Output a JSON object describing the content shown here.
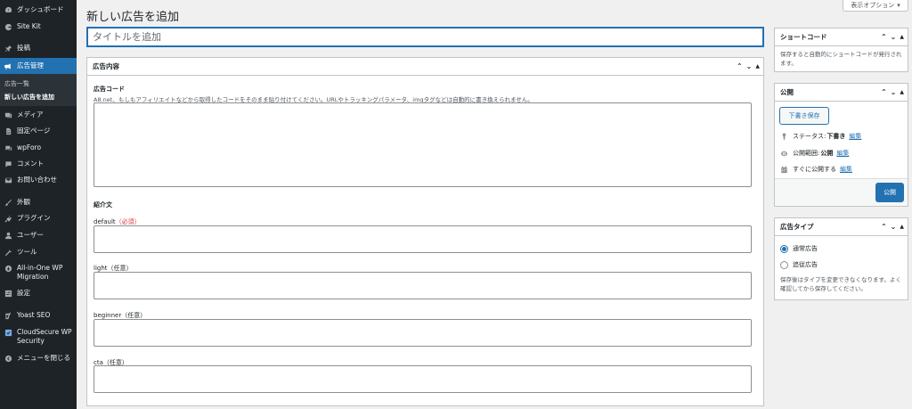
{
  "sidebar": {
    "items": [
      {
        "label": "ダッシュボード",
        "icon": "dashboard-icon"
      },
      {
        "label": "Site Kit",
        "icon": "google-g-icon"
      },
      {
        "label": "投稿",
        "icon": "pin-icon"
      },
      {
        "label": "広告管理",
        "icon": "megaphone-icon"
      },
      {
        "label": "メディア",
        "icon": "media-icon"
      },
      {
        "label": "固定ページ",
        "icon": "page-icon"
      },
      {
        "label": "wpForo",
        "icon": "forum-icon"
      },
      {
        "label": "コメント",
        "icon": "comment-icon"
      },
      {
        "label": "お問い合わせ",
        "icon": "mail-icon"
      },
      {
        "label": "外観",
        "icon": "brush-icon"
      },
      {
        "label": "プラグイン",
        "icon": "plugin-icon"
      },
      {
        "label": "ユーザー",
        "icon": "user-icon"
      },
      {
        "label": "ツール",
        "icon": "wrench-icon"
      },
      {
        "label": "All-in-One WP",
        "label2": "Migration",
        "icon": "migration-icon"
      },
      {
        "label": "設定",
        "icon": "settings-icon"
      },
      {
        "label": "Yoast SEO",
        "icon": "yoast-icon"
      },
      {
        "label": "CloudSecure WP",
        "label2": "Security",
        "icon": "shield-icon"
      },
      {
        "label": "メニューを閉じる",
        "icon": "collapse-icon"
      }
    ],
    "submenu": [
      {
        "label": "広告一覧"
      },
      {
        "label": "新しい広告を追加"
      }
    ]
  },
  "header": {
    "title": "新しい広告を追加",
    "screen_options": "表示オプション"
  },
  "title_input": {
    "placeholder": "タイトルを追加"
  },
  "ad_content": {
    "title": "広告内容",
    "code_label": "広告コード",
    "code_desc": "A8.net、もしもアフィリエイトなどから取得したコードをそのまま貼り付けてください。URLやトラッキングパラメータ、imgタグなどは自動的に書き換えられません。",
    "intro_label": "紹介文",
    "fields": [
      {
        "label": "default",
        "note": "（必須）"
      },
      {
        "label": "light（任意）"
      },
      {
        "label": "beginner（任意）"
      },
      {
        "label": "cta（任意）"
      }
    ]
  },
  "shortcode_box": {
    "title": "ショートコード",
    "text": "保存すると自動的にショートコードが発行されます。"
  },
  "publish_box": {
    "title": "公開",
    "save_draft": "下書き保存",
    "status_label": "ステータス:",
    "status_value": "下書き",
    "visibility_label": "公開範囲:",
    "visibility_value": "公開",
    "schedule_label": "すぐに公開する",
    "edit_link": "編集",
    "publish_button": "公開"
  },
  "ad_type_box": {
    "title": "広告タイプ",
    "options": [
      "通常広告",
      "追従広告"
    ],
    "selected": "通常広告",
    "note": "保存後はタイプを変更できなくなります。よく確認してから保存してください。"
  },
  "colors": {
    "sidebar_bg": "#1d2327",
    "accent": "#2271b1",
    "required": "#d63638"
  }
}
